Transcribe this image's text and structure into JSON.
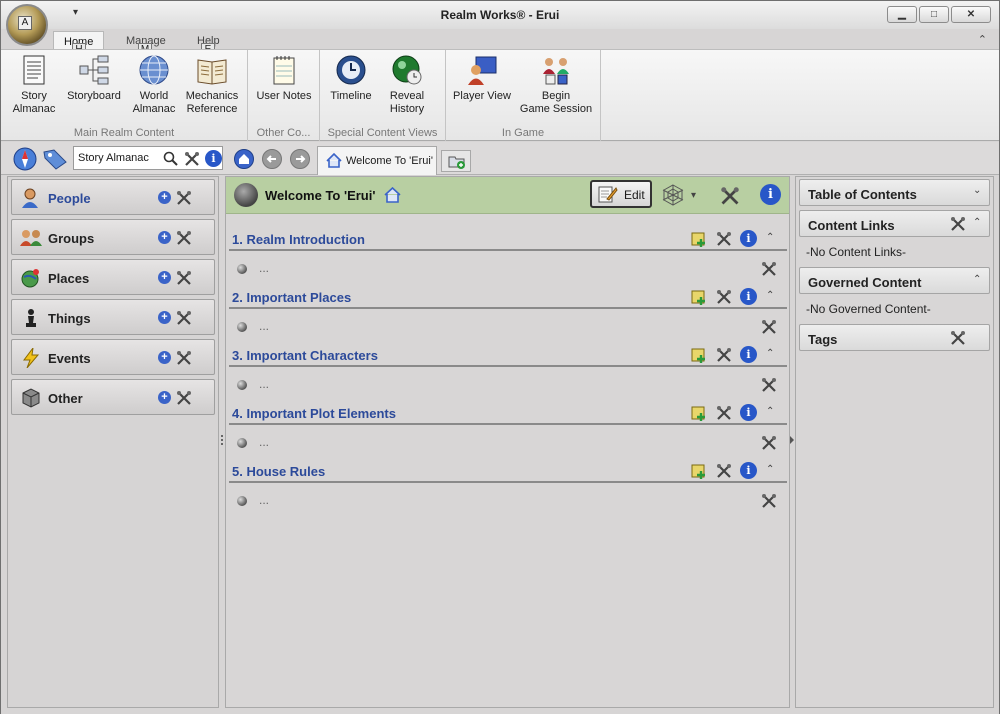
{
  "window": {
    "title": "Realm Works® - Erui",
    "app_key": "A",
    "qat_glyph": "▾",
    "minimize": "▁",
    "maximize": "□",
    "close": "✕",
    "collapse_glyph": "⌃"
  },
  "ribbon_tabs": [
    {
      "label": "Home",
      "key": "H",
      "active": true
    },
    {
      "label": "Manage",
      "key": "M",
      "active": false
    },
    {
      "label": "Help",
      "key": "E",
      "active": false
    }
  ],
  "ribbon": {
    "groups": [
      {
        "label": "Main Realm Content",
        "buttons": [
          "Story\nAlmanac",
          "Storyboard",
          "World\nAlmanac",
          "Mechanics\nReference"
        ]
      },
      {
        "label": "Other Co...",
        "buttons": [
          "User Notes"
        ]
      },
      {
        "label": "Special Content Views",
        "buttons": [
          "Timeline",
          "Reveal\nHistory"
        ]
      },
      {
        "label": "In Game",
        "buttons": [
          "Player View",
          "Begin\nGame Session"
        ]
      }
    ]
  },
  "nav": {
    "search_value": "Story Almanac",
    "doc_tab": "Welcome To 'Erui'"
  },
  "left_pane": {
    "categories": [
      {
        "label": "People",
        "icon": "person-icon",
        "active": true
      },
      {
        "label": "Groups",
        "icon": "group-icon",
        "active": false
      },
      {
        "label": "Places",
        "icon": "globe-pin-icon",
        "active": false
      },
      {
        "label": "Things",
        "icon": "chess-piece-icon",
        "active": false
      },
      {
        "label": "Events",
        "icon": "lightning-icon",
        "active": false
      },
      {
        "label": "Other",
        "icon": "cube-icon",
        "active": false
      }
    ],
    "plus_glyph": "+"
  },
  "center": {
    "topic_title": "Welcome To 'Erui'",
    "edit_label": "Edit",
    "info_glyph": "i",
    "dropdown_glyph": "▾",
    "sections": [
      {
        "title": "1. Realm Introduction",
        "content": "..."
      },
      {
        "title": "2. Important Places",
        "content": "..."
      },
      {
        "title": "3. Important Characters",
        "content": "..."
      },
      {
        "title": "4. Important Plot Elements",
        "content": "..."
      },
      {
        "title": "5. House Rules",
        "content": "..."
      }
    ],
    "collapse_glyph": "⌃"
  },
  "right_pane": {
    "toc": "Table of Contents",
    "content_links": "Content Links",
    "content_links_empty": "-No Content Links-",
    "governed": "Governed Content",
    "governed_empty": "-No Governed Content-",
    "tags": "Tags",
    "expand_glyph": "⌄",
    "collapse_glyph": "⌃"
  },
  "colors": {
    "topic_header": "#b8cfa2",
    "link_blue": "#2c4a9a",
    "accent_blue": "#2857c8"
  }
}
